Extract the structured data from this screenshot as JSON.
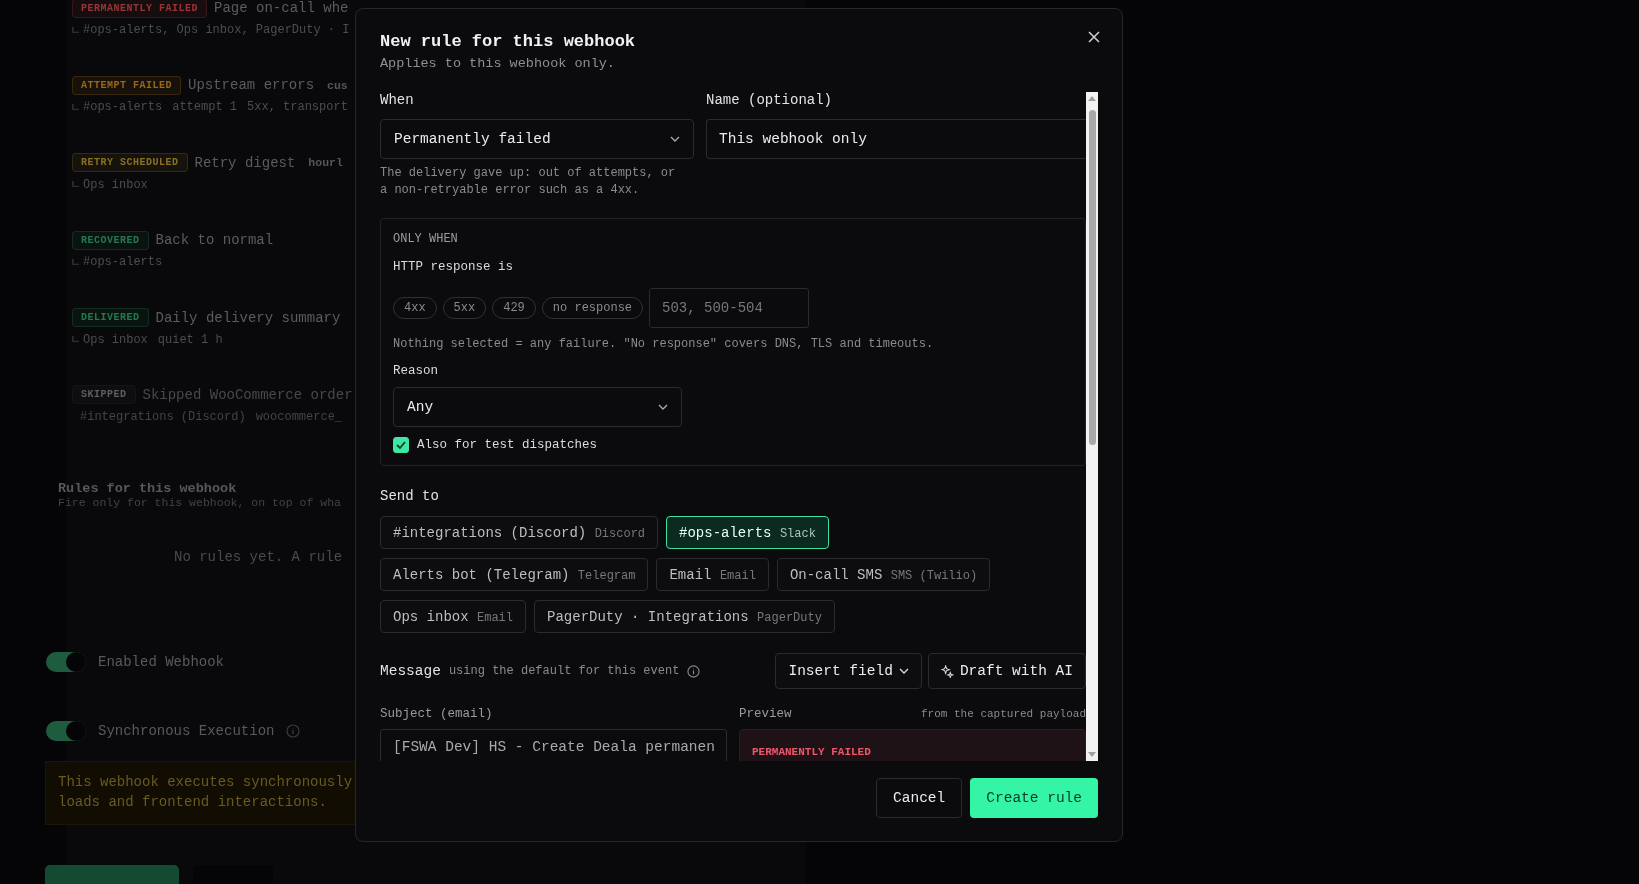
{
  "background": {
    "events": [
      {
        "badge": "PERMANENTLY FAILED",
        "color": "#9a3438",
        "title": "Page on-call whe",
        "meta": [
          "#ops-alerts, Ops inbox, PagerDuty · I"
        ],
        "muted": false
      },
      {
        "badge": "ATTEMPT FAILED",
        "color": "#9a6618",
        "title": "Upstream errors",
        "tag": "cus",
        "meta": [
          "#ops-alerts",
          "attempt 1",
          "5xx, transport"
        ],
        "muted": false
      },
      {
        "badge": "RETRY SCHEDULED",
        "color": "#8a7020",
        "title": "Retry digest",
        "tag": "hourl",
        "meta": [
          "Ops inbox"
        ],
        "muted": false
      },
      {
        "badge": "RECOVERED",
        "color": "#237a50",
        "title": "Back to normal",
        "meta": [
          "#ops-alerts"
        ],
        "muted": false
      },
      {
        "badge": "DELIVERED",
        "color": "#237a50",
        "title": "Daily delivery summary",
        "meta": [
          "Ops inbox",
          "quiet 1 h"
        ],
        "muted": false
      },
      {
        "badge": "SKIPPED",
        "color": "#5c5e66",
        "title": "Skipped WooCommerce order",
        "meta": [
          "#integrations (Discord)",
          "woocommerce_"
        ],
        "muted": true
      }
    ],
    "rules": {
      "title": "Rules for this webhook",
      "subtitle": "Fire only for this webhook, on top of wha",
      "empty": "No rules yet. A rule"
    },
    "toggles": [
      {
        "label": "Enabled Webhook",
        "on": true,
        "info": false
      },
      {
        "label": "Synchronous Execution",
        "on": true,
        "info": true
      }
    ],
    "warning": "This webhook executes synchronously\nloads and frontend interactions."
  },
  "dialog": {
    "title": "New rule for this webhook",
    "subtitle": "Applies to this webhook only.",
    "when": {
      "label": "When",
      "value": "Permanently failed",
      "help": "The delivery gave up: out of attempts, or\na non-retryable error such as a 4xx."
    },
    "name": {
      "label": "Name (optional)",
      "value": "This webhook only"
    },
    "only_when": {
      "heading": "ONLY WHEN",
      "http_label": "HTTP response is",
      "chips": [
        {
          "label": "4xx",
          "selected": false
        },
        {
          "label": "5xx",
          "selected": false
        },
        {
          "label": "429",
          "selected": false
        },
        {
          "label": "no response",
          "selected": false
        }
      ],
      "codes_placeholder": "503, 500-504",
      "help": "Nothing selected = any failure. \"No response\" covers DNS, TLS and timeouts.",
      "reason": {
        "label": "Reason",
        "value": "Any"
      },
      "test_dispatches": {
        "label": "Also for test dispatches",
        "checked": true
      }
    },
    "send_to": {
      "label": "Send to",
      "channels": [
        {
          "name": "#integrations (Discord)",
          "type": "Discord",
          "selected": false
        },
        {
          "name": "#ops-alerts",
          "type": "Slack",
          "selected": true
        },
        {
          "name": "Alerts bot (Telegram)",
          "type": "Telegram",
          "selected": false
        },
        {
          "name": "Email",
          "type": "Email",
          "selected": false
        },
        {
          "name": "On-call SMS",
          "type": "SMS (Twilio)",
          "selected": false
        },
        {
          "name": "Ops inbox",
          "type": "Email",
          "selected": false
        },
        {
          "name": "PagerDuty · Integrations",
          "type": "PagerDuty",
          "selected": false
        }
      ]
    },
    "message": {
      "label": "Message",
      "hint": "using the default for this event",
      "insert_button": "Insert field",
      "draft_button": "Draft with AI"
    },
    "subject": {
      "label": "Subject (email)",
      "value": "[FSWA Dev] HS - Create Deala permanen"
    },
    "preview": {
      "label": "Preview",
      "note": "from the captured payload",
      "badge": "PERMANENTLY FAILED"
    },
    "buttons": {
      "cancel": "Cancel",
      "create": "Create rule"
    }
  }
}
